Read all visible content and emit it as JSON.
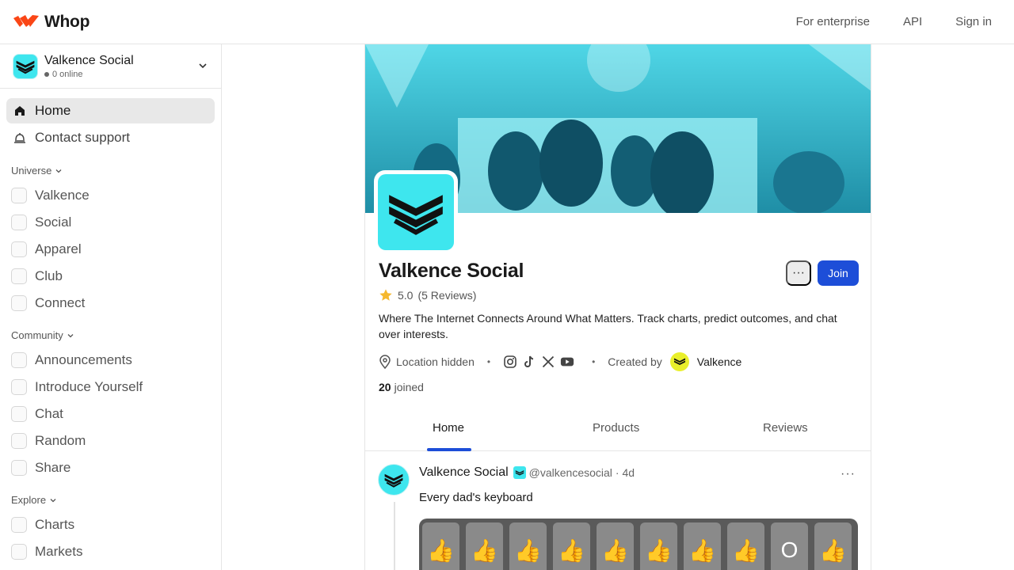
{
  "topbar": {
    "brand": "Whop",
    "nav": [
      "For enterprise",
      "API",
      "Sign in"
    ]
  },
  "sidebar": {
    "community_name": "Valkence Social",
    "online": "0 online",
    "primary": [
      {
        "label": "Home",
        "icon": "home-icon",
        "active": true
      },
      {
        "label": "Contact support",
        "icon": "bell-icon",
        "active": false
      }
    ],
    "sections": [
      {
        "label": "Universe",
        "items": [
          "Valkence",
          "Social",
          "Apparel",
          "Club",
          "Connect"
        ]
      },
      {
        "label": "Community",
        "items": [
          "Announcements",
          "Introduce Yourself",
          "Chat",
          "Random",
          "Share"
        ]
      },
      {
        "label": "Explore",
        "items": [
          "Charts",
          "Markets"
        ]
      }
    ]
  },
  "profile": {
    "title": "Valkence Social",
    "join_label": "Join",
    "more_label": "···",
    "rating": "5.0",
    "reviews": "(5 Reviews)",
    "description": "Where The Internet Connects Around What Matters. Track charts, predict outcomes, and chat over interests.",
    "location": "Location hidden",
    "socials": [
      "instagram-icon",
      "tiktok-icon",
      "x-icon",
      "youtube-icon"
    ],
    "created_by_label": "Created by",
    "creator": "Valkence",
    "joined_count": "20",
    "joined_label": "joined"
  },
  "tabs": [
    "Home",
    "Products",
    "Reviews"
  ],
  "post": {
    "author": "Valkence Social",
    "handle": "@valkencesocial",
    "age": "· 4d",
    "text": "Every dad's keyboard",
    "keys": [
      "👍",
      "👍",
      "👍",
      "👍",
      "👍",
      "👍",
      "👍",
      "👍",
      "O",
      "👍"
    ]
  },
  "colors": {
    "accent": "#1d4ed8",
    "brand_cyan": "#3ee6ee",
    "whop_orange": "#fa4616"
  }
}
